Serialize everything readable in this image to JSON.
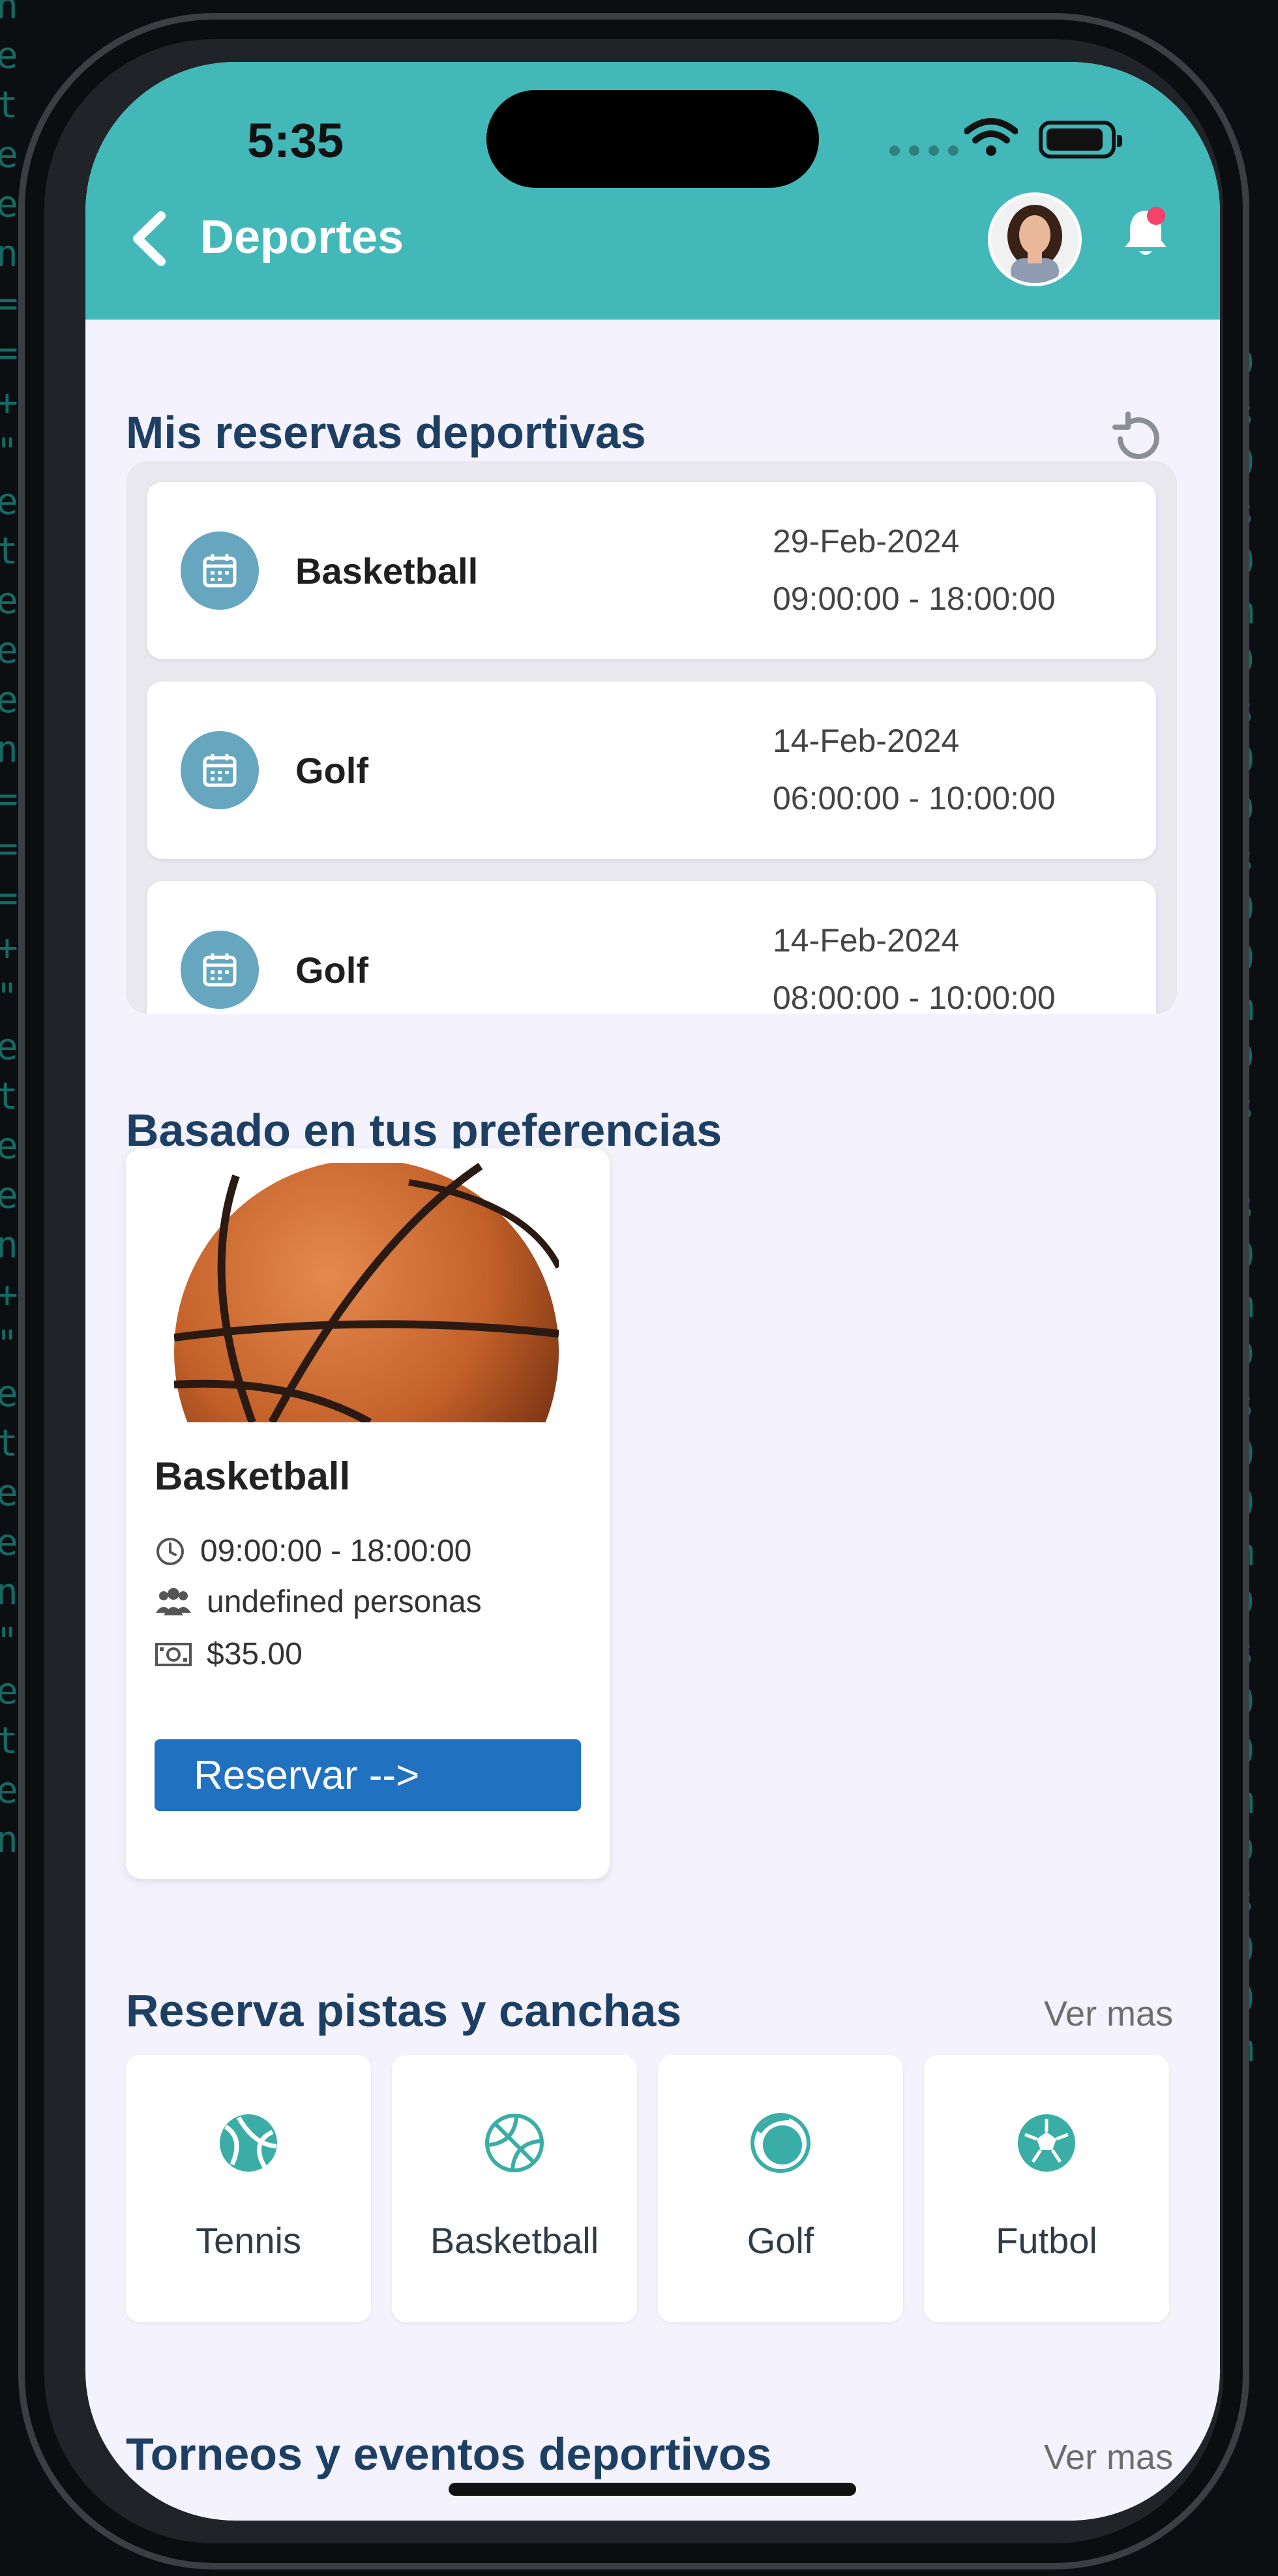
{
  "status_bar": {
    "time": "5:35"
  },
  "header": {
    "title": "Deportes"
  },
  "reservations": {
    "title": "Mis reservas deportivas",
    "items": [
      {
        "sport": "Basketball",
        "date": "29-Feb-2024",
        "time": "09:00:00 - 18:00:00"
      },
      {
        "sport": "Golf",
        "date": "14-Feb-2024",
        "time": "06:00:00 - 10:00:00"
      },
      {
        "sport": "Golf",
        "date": "14-Feb-2024",
        "time": "08:00:00 - 10:00:00"
      }
    ]
  },
  "preferences": {
    "title": "Basado en tus preferencias",
    "card": {
      "name": "Basketball",
      "time": "09:00:00 - 18:00:00",
      "people": "undefined personas",
      "price": "$35.00",
      "button": "Reservar -->"
    }
  },
  "courts": {
    "title": "Reserva pistas y canchas",
    "see_more": "Ver mas",
    "items": [
      {
        "label": "Tennis",
        "icon": "tennis-ball-icon"
      },
      {
        "label": "Basketball",
        "icon": "basketball-icon"
      },
      {
        "label": "Golf",
        "icon": "golf-ball-icon"
      },
      {
        "label": "Futbol",
        "icon": "soccer-ball-icon"
      }
    ]
  },
  "events": {
    "title": "Torneos y eventos deportivos",
    "see_more": "Ver mas"
  },
  "colors": {
    "header": "#43b8b8",
    "title": "#1d3f63",
    "button": "#2171c1",
    "icon": "#3aaea6",
    "calendar_icon_bg": "#66a7bf"
  }
}
